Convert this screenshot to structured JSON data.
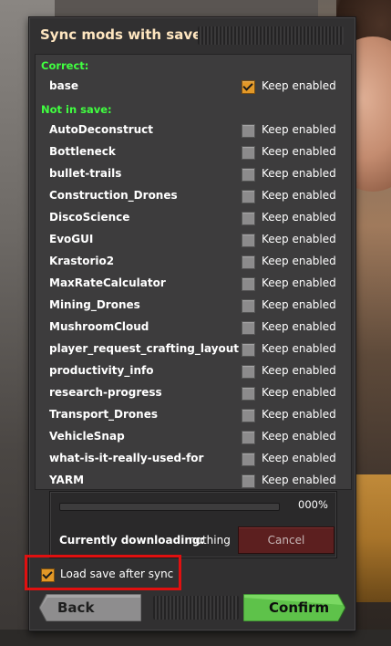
{
  "dialog": {
    "title": "Sync mods with save"
  },
  "sections": {
    "correct_label": "Correct:",
    "not_in_save_label": "Not in save:"
  },
  "keep_enabled_label": "Keep enabled",
  "correct_mods": [
    {
      "name": "base",
      "keep_enabled": true
    }
  ],
  "not_in_save_mods": [
    {
      "name": "AutoDeconstruct",
      "keep_enabled": false
    },
    {
      "name": "Bottleneck",
      "keep_enabled": false
    },
    {
      "name": "bullet-trails",
      "keep_enabled": false
    },
    {
      "name": "Construction_Drones",
      "keep_enabled": false
    },
    {
      "name": "DiscoScience",
      "keep_enabled": false
    },
    {
      "name": "EvoGUI",
      "keep_enabled": false
    },
    {
      "name": "Krastorio2",
      "keep_enabled": false
    },
    {
      "name": "MaxRateCalculator",
      "keep_enabled": false
    },
    {
      "name": "Mining_Drones",
      "keep_enabled": false
    },
    {
      "name": "MushroomCloud",
      "keep_enabled": false
    },
    {
      "name": "player_request_crafting_layout",
      "keep_enabled": false
    },
    {
      "name": "productivity_info",
      "keep_enabled": false
    },
    {
      "name": "research-progress",
      "keep_enabled": false
    },
    {
      "name": "Transport_Drones",
      "keep_enabled": false
    },
    {
      "name": "VehicleSnap",
      "keep_enabled": false
    },
    {
      "name": "what-is-it-really-used-for",
      "keep_enabled": false
    },
    {
      "name": "YARM",
      "keep_enabled": false
    }
  ],
  "download": {
    "progress_text": "000%",
    "progress_fraction": 0,
    "label": "Currently downloading:",
    "value": "nothing",
    "cancel_label": "Cancel"
  },
  "load_save": {
    "label": "Load save after sync",
    "checked": true
  },
  "footer": {
    "back_label": "Back",
    "confirm_label": "Confirm"
  },
  "colors": {
    "section_green": "#40ff40",
    "checkbox_orange": "#e39827",
    "confirm_green": "#5ec24a",
    "cancel_red": "#5c1f1f",
    "highlight_red": "#e01010"
  }
}
